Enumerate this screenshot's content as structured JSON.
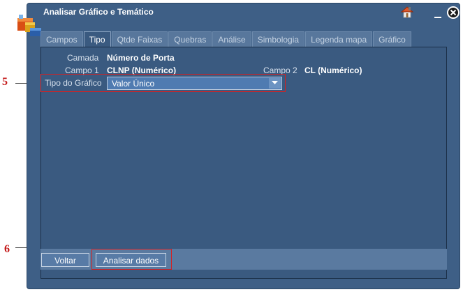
{
  "window": {
    "title": "Analisar Gráfico e Temático"
  },
  "titlebar_icons": [
    "home-icon",
    "minimize-icon",
    "close-icon"
  ],
  "tabs": [
    {
      "label": "Campos",
      "active": false
    },
    {
      "label": "Tipo",
      "active": true
    },
    {
      "label": "Qtde Faixas",
      "active": false
    },
    {
      "label": "Quebras",
      "active": false
    },
    {
      "label": "Análise",
      "active": false
    },
    {
      "label": "Simbologia",
      "active": false
    },
    {
      "label": "Legenda mapa",
      "active": false
    },
    {
      "label": "Gráfico",
      "active": false
    }
  ],
  "form": {
    "camada_label": "Camada",
    "camada_value": "Número de Porta",
    "campo1_label": "Campo 1",
    "campo1_value": "CLNP (Numérico)",
    "campo2_label": "Campo 2",
    "campo2_value": "CL (Numérico)",
    "tipo_label": "Tipo do Gráfico",
    "tipo_value": "Valor Único"
  },
  "buttons": {
    "back": "Voltar",
    "analyze": "Analisar dados"
  },
  "annotations": {
    "marker5": "5",
    "marker6": "6"
  },
  "colors": {
    "window_bg": "#3e5f86",
    "annotation_red": "#d62020"
  }
}
